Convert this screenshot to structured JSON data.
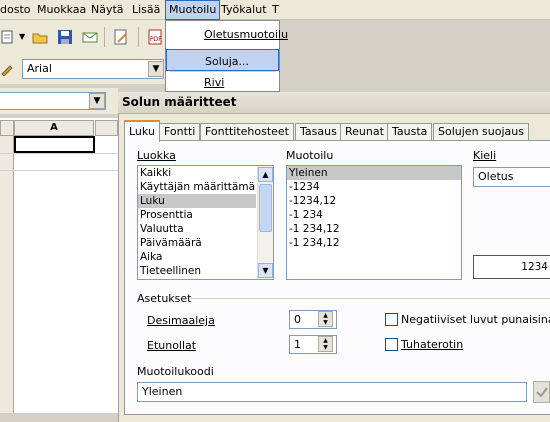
{
  "menubar": {
    "items": [
      "dosto",
      "Muokkaa",
      "Näytä",
      "Lisää",
      "Muotoilu",
      "Työkalut",
      "T"
    ]
  },
  "toolbar": {
    "font_name": "Arial"
  },
  "sheet": {
    "column_a": "A"
  },
  "format_menu": {
    "items": [
      "Oletusmuotoilu",
      "Soluja...",
      "Rivi"
    ]
  },
  "dialog": {
    "title": "Solun määritteet",
    "tabs": [
      "Luku",
      "Fontti",
      "Fonttitehosteet",
      "Tasaus",
      "Reunat",
      "Tausta",
      "Solujen suojaus"
    ],
    "category_label": "Luokka",
    "categories": [
      "Kaikki",
      "Käyttäjän määrittämä",
      "Luku",
      "Prosenttia",
      "Valuutta",
      "Päivämäärä",
      "Aika",
      "Tieteellinen"
    ],
    "format_label": "Muotoilu",
    "formats": [
      "Yleinen",
      "-1234",
      "-1234,12",
      "-1 234",
      "-1 234,12",
      "-1 234,12"
    ],
    "language_label": "Kieli",
    "language_value": "Oletus",
    "preview_value": "1234",
    "options_label": "Asetukset",
    "decimals_label": "Desimaaleja",
    "decimals_value": "0",
    "leading_zeros_label": "Etunollat",
    "leading_zeros_value": "1",
    "negative_red_label": "Negatiiviset luvut punaisina",
    "thousands_sep_label": "Tuhaterotin",
    "format_code_label": "Muotoilukoodi",
    "format_code_value": "Yleinen"
  }
}
